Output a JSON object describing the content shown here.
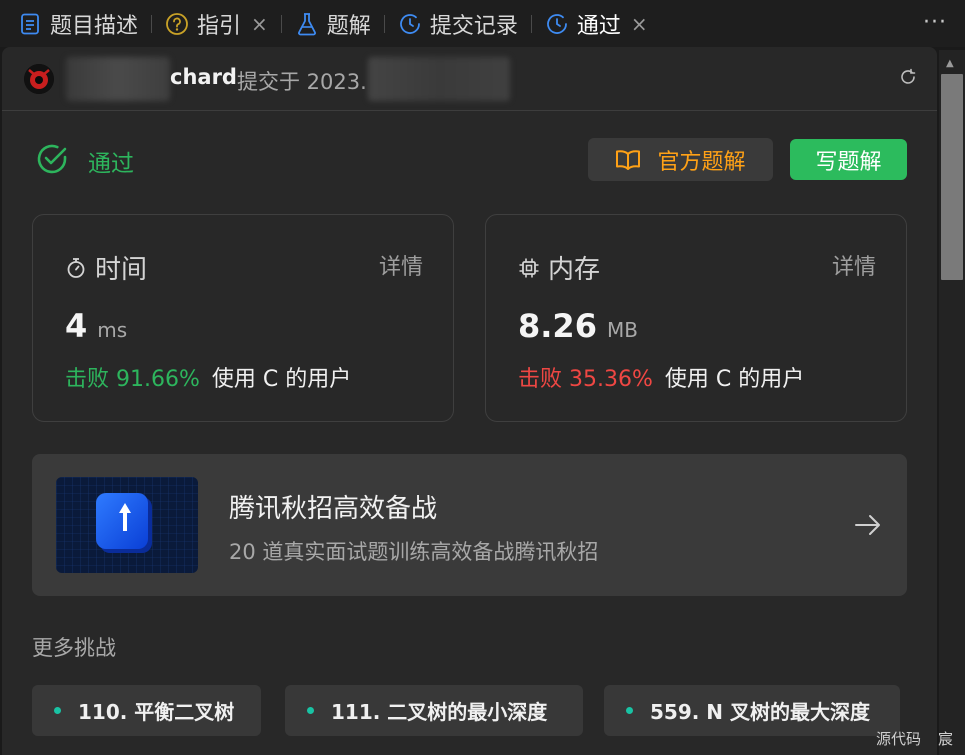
{
  "tabs": [
    {
      "label": "题目描述"
    },
    {
      "label": "指引"
    },
    {
      "label": "题解"
    },
    {
      "label": "提交记录"
    },
    {
      "label": "通过"
    }
  ],
  "tab_close_glyph": "×",
  "more_glyph": "···",
  "submission": {
    "submitter": "chard",
    "submitted_at": "提交于 2023."
  },
  "status": {
    "label": "通过"
  },
  "buttons": {
    "official_solution": "官方题解",
    "write_solution": "写题解"
  },
  "time_card": {
    "title": "时间",
    "detail": "详情",
    "value": "4",
    "unit": "ms",
    "beat": "击败 91.66%",
    "suffix": "使用 C 的用户"
  },
  "memory_card": {
    "title": "内存",
    "detail": "详情",
    "value": "8.26",
    "unit": "MB",
    "beat": "击败 35.36%",
    "suffix": "使用 C 的用户"
  },
  "promo": {
    "title": "腾讯秋招高效备战",
    "subtitle": "20 道真实面试题训练高效备战腾讯秋招"
  },
  "more_challenges": {
    "title": "更多挑战",
    "items": [
      {
        "label": "110. 平衡二叉树"
      },
      {
        "label": "111. 二叉树的最小深度"
      },
      {
        "label": "559. N 叉树的最大深度"
      }
    ]
  },
  "footer": {
    "text1": "源代码",
    "text2": "宸"
  },
  "colors": {
    "accept_green": "#2db55d",
    "beat_red": "#ef4743",
    "official_orange": "#ffa116",
    "write_button_green": "#2cbb5d",
    "chip_dot_teal": "#19c3a4",
    "tab_blue": "#3e8bf2"
  },
  "icons": {
    "tab_description": "document-icon",
    "tab_guide": "question-circle-icon",
    "tab_solutions": "flask-icon",
    "tab_submissions": "history-clock-icon",
    "tab_accepted": "history-clock-icon",
    "status": "check-circle-icon",
    "official": "book-icon",
    "time": "stopwatch-icon",
    "memory": "chip-icon",
    "promo_arrow": "arrow-right-icon",
    "refresh": "refresh-icon"
  }
}
